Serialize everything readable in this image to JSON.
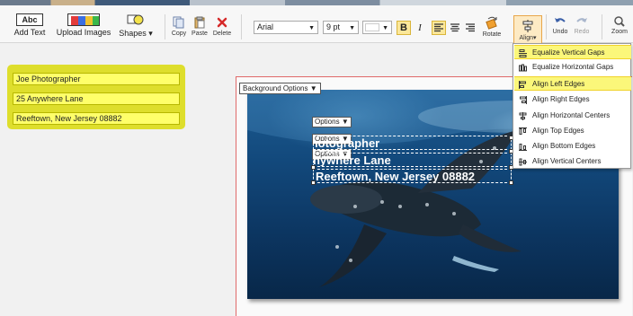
{
  "toolbar": {
    "add_text": {
      "icon_text": "Abc",
      "label": "Add Text"
    },
    "upload_images": {
      "label": "Upload Images"
    },
    "shapes": {
      "label": "Shapes"
    },
    "copy": "Copy",
    "paste": "Paste",
    "delete": "Delete",
    "font_family": "Arial",
    "font_size": "9 pt",
    "bold": "B",
    "italic": "I",
    "rotate": "Rotate",
    "align": "Align",
    "undo": "Undo",
    "redo": "Redo",
    "zoom": "Zoom"
  },
  "align_menu": {
    "items": [
      {
        "label": "Equalize Vertical Gaps",
        "highlighted": true
      },
      {
        "label": "Equalize Horizontal Gaps",
        "highlighted": false
      },
      {
        "label": "Align Left Edges",
        "highlighted": true
      },
      {
        "label": "Align Right Edges",
        "highlighted": false
      },
      {
        "label": "Align Horizontal Centers",
        "highlighted": false
      },
      {
        "label": "Align Top Edges",
        "highlighted": false
      },
      {
        "label": "Align Bottom Edges",
        "highlighted": false
      },
      {
        "label": "Align Vertical Centers",
        "highlighted": false
      }
    ]
  },
  "fields": [
    "Joe Photographer",
    "25 Anywhere Lane",
    "Reeftown, New Jersey 08882"
  ],
  "canvas": {
    "background_options": "Background Options",
    "options_label": "Options",
    "text_lines": [
      "Joe Photographer",
      "25 Anywhere Lane",
      "Reeftown, New Jersey 08882"
    ]
  },
  "colors": {
    "highlight": "#fbf77a",
    "panel": "#dede2c",
    "field": "#ffff6a",
    "align_active": "#fdeac4"
  }
}
